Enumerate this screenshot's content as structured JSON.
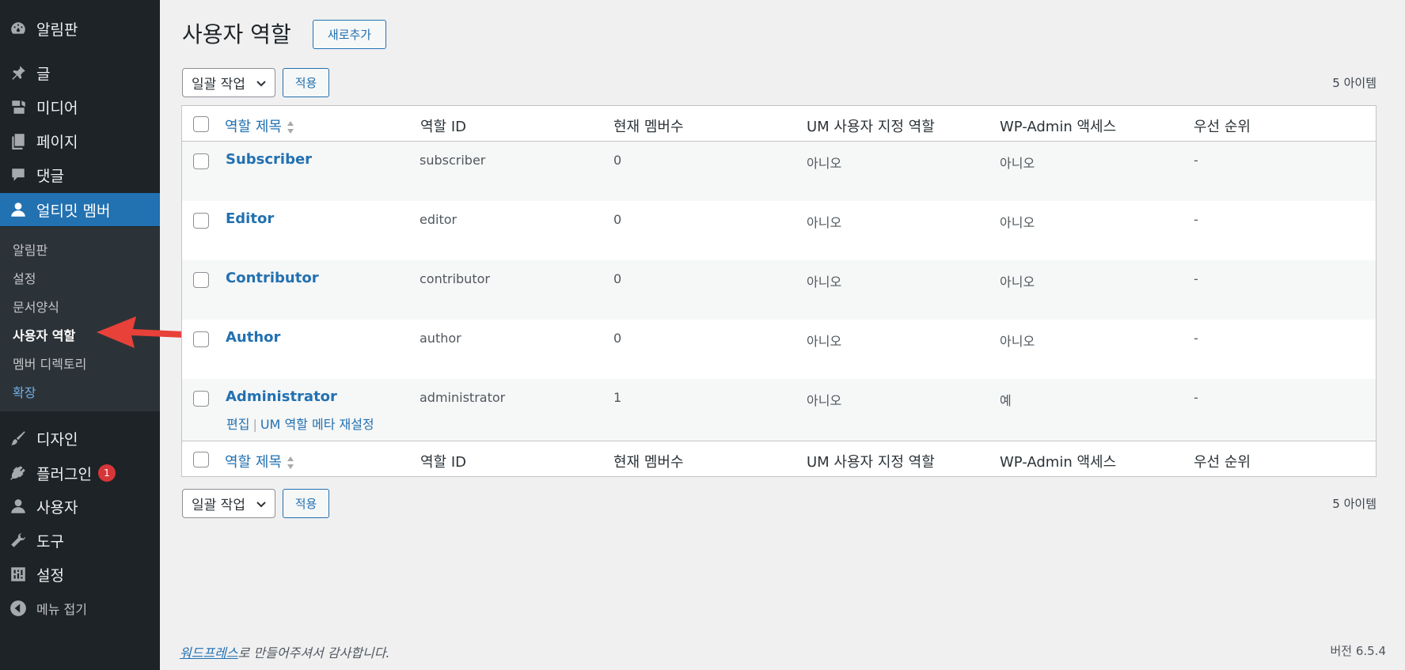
{
  "sidebar": {
    "items": [
      {
        "label": "알림판",
        "icon": "dashboard-icon"
      },
      {
        "label": "글",
        "icon": "pin-icon"
      },
      {
        "label": "미디어",
        "icon": "media-icon"
      },
      {
        "label": "페이지",
        "icon": "pages-icon"
      },
      {
        "label": "댓글",
        "icon": "comments-icon"
      },
      {
        "label": "얼티밋 멤버",
        "icon": "user-icon"
      },
      {
        "label": "디자인",
        "icon": "brush-icon"
      },
      {
        "label": "플러그인",
        "icon": "plugin-icon",
        "badge": "1"
      },
      {
        "label": "사용자",
        "icon": "users-icon"
      },
      {
        "label": "도구",
        "icon": "wrench-icon"
      },
      {
        "label": "설정",
        "icon": "settings-icon"
      }
    ],
    "submenu": [
      "알림판",
      "설정",
      "문서양식",
      "사용자 역할",
      "멤버 디렉토리",
      "확장"
    ],
    "collapse_label": "메뉴 접기"
  },
  "header": {
    "title": "사용자 역할",
    "add_new": "새로추가"
  },
  "bulk": {
    "select_label": "일괄 작업",
    "apply_label": "적용",
    "count": "5 아이템"
  },
  "table": {
    "columns": [
      "역할 제목",
      "역할 ID",
      "현재 멤버수",
      "UM 사용자 지정 역할",
      "WP-Admin 액세스",
      "우선 순위"
    ],
    "rows": [
      {
        "title": "Subscriber",
        "id": "subscriber",
        "members": "0",
        "custom": "아니오",
        "admin": "아니오",
        "priority": "-"
      },
      {
        "title": "Editor",
        "id": "editor",
        "members": "0",
        "custom": "아니오",
        "admin": "아니오",
        "priority": "-"
      },
      {
        "title": "Contributor",
        "id": "contributor",
        "members": "0",
        "custom": "아니오",
        "admin": "아니오",
        "priority": "-"
      },
      {
        "title": "Author",
        "id": "author",
        "members": "0",
        "custom": "아니오",
        "admin": "아니오",
        "priority": "-"
      },
      {
        "title": "Administrator",
        "id": "administrator",
        "members": "1",
        "custom": "아니오",
        "admin": "예",
        "priority": "-"
      }
    ],
    "row_actions": {
      "edit": "편집",
      "reset": "UM 역할 메타 재설정"
    }
  },
  "footer": {
    "thanks_link": "워드프레스",
    "thanks_rest": "로 만들어주셔서 감사합니다.",
    "version": "버전 6.5.4"
  },
  "colors": {
    "sidebar_bg": "#1d2327",
    "accent": "#2271b1",
    "arrow": "#e8413a"
  }
}
